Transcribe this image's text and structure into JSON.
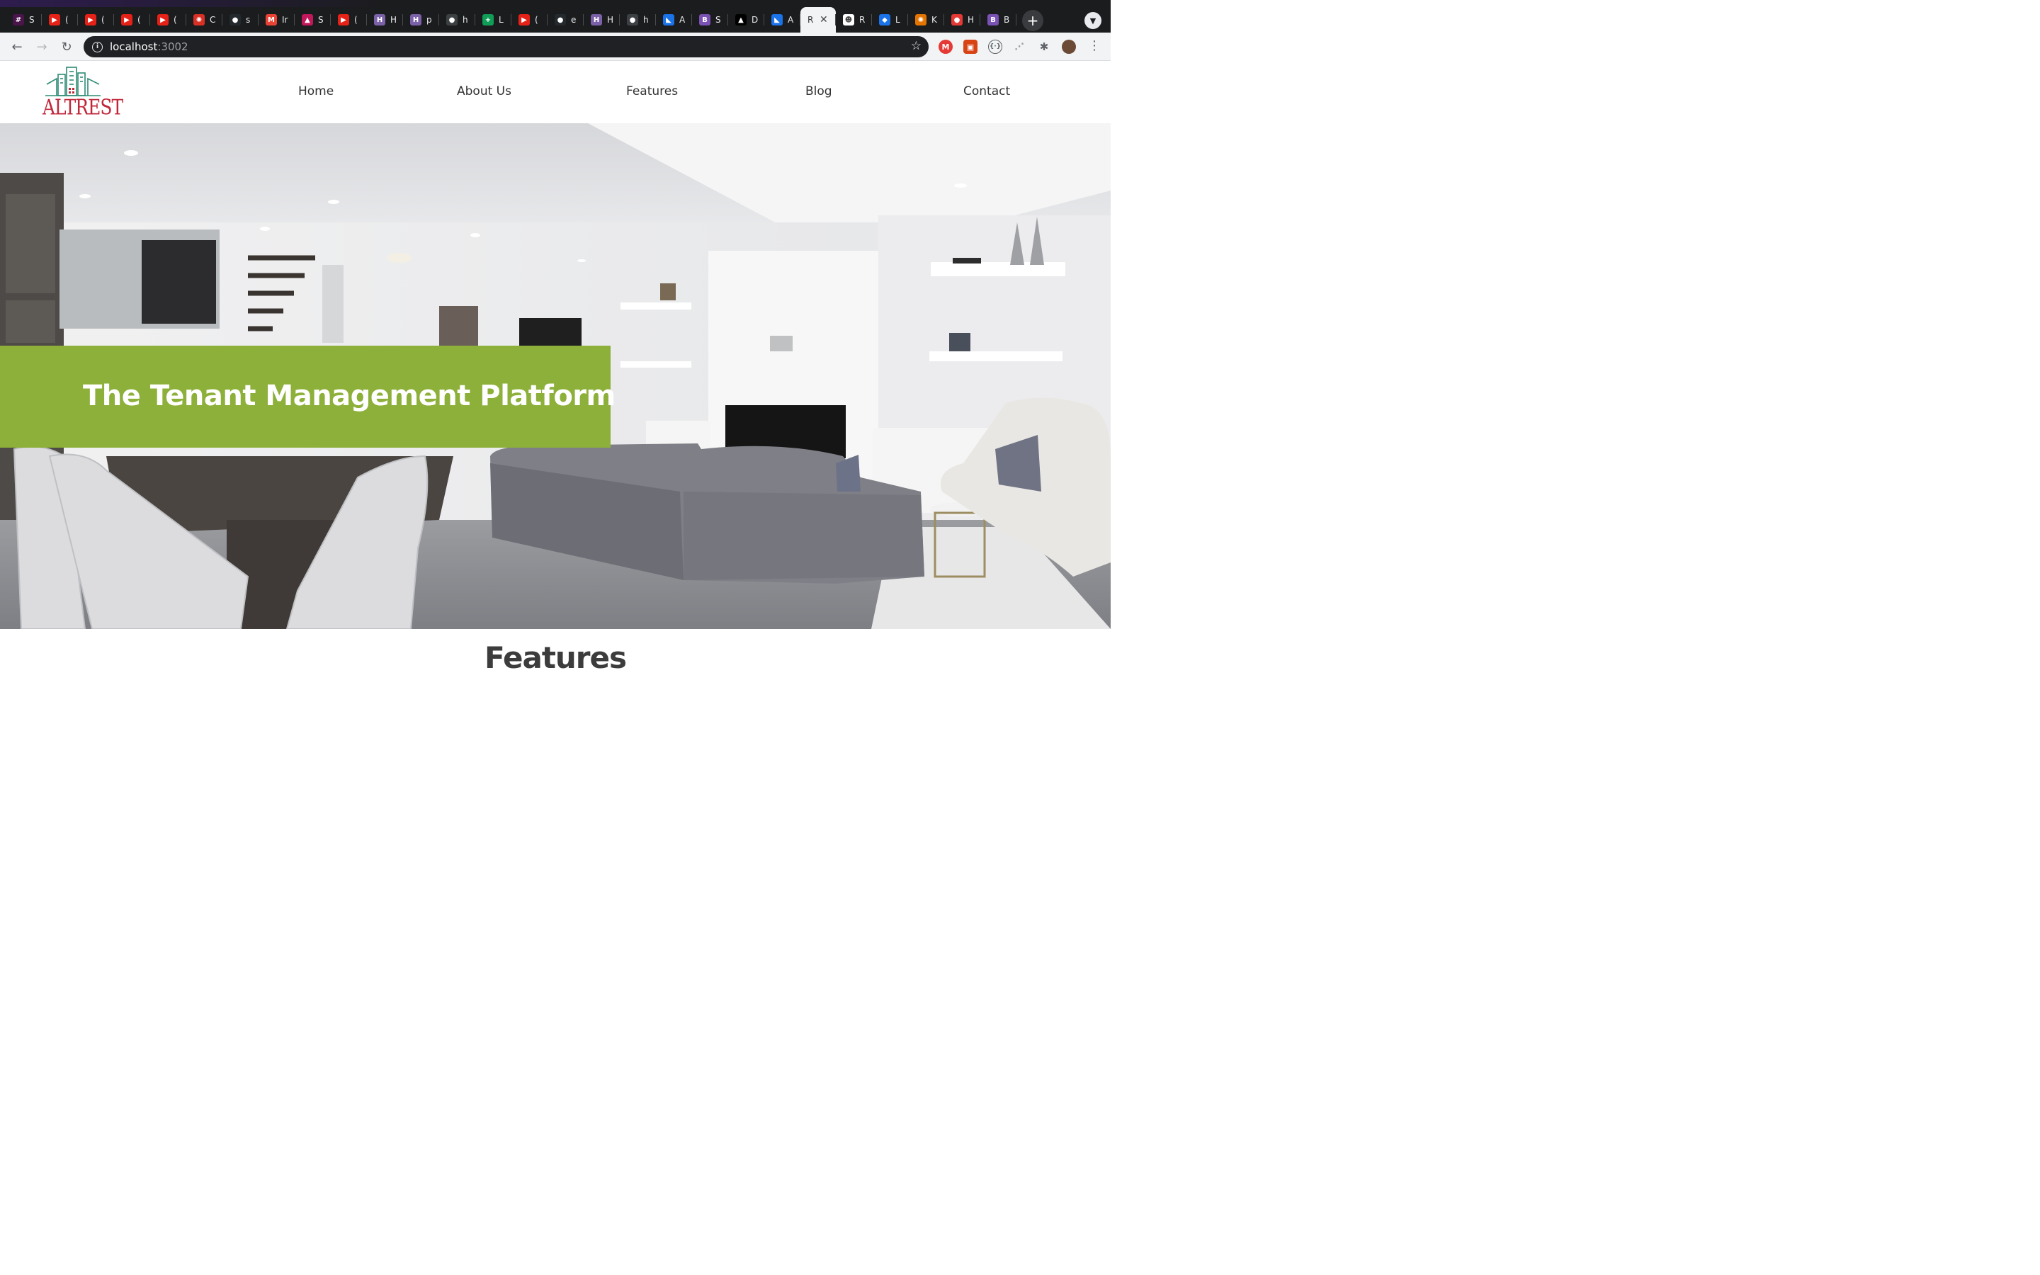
{
  "browser": {
    "tabs": [
      {
        "title": "S",
        "color": "#4a154b",
        "glyph": "#",
        "icon": "slack-icon"
      },
      {
        "title": "(",
        "color": "#e62117",
        "glyph": "▶",
        "icon": "youtube-icon"
      },
      {
        "title": "(",
        "color": "#e62117",
        "glyph": "▶",
        "icon": "youtube-icon"
      },
      {
        "title": "(",
        "color": "#e62117",
        "glyph": "▶",
        "icon": "youtube-icon"
      },
      {
        "title": "(",
        "color": "#e62117",
        "glyph": "▶",
        "icon": "youtube-icon"
      },
      {
        "title": "C",
        "color": "#d93025",
        "glyph": "✺",
        "icon": "sunburst-icon"
      },
      {
        "title": "s",
        "color": "#24292e",
        "glyph": "●",
        "icon": "github-icon"
      },
      {
        "title": "Ir",
        "color": "#ea4335",
        "glyph": "M",
        "icon": "gmail-icon"
      },
      {
        "title": "S",
        "color": "#c2185b",
        "glyph": "▲",
        "icon": "app-icon"
      },
      {
        "title": "(",
        "color": "#e62117",
        "glyph": "▶",
        "icon": "youtube-icon"
      },
      {
        "title": "H",
        "color": "#7b61a8",
        "glyph": "H",
        "icon": "heroku-icon"
      },
      {
        "title": "p",
        "color": "#7b61a8",
        "glyph": "H",
        "icon": "heroku-icon"
      },
      {
        "title": "h",
        "color": "#3c4043",
        "glyph": "●",
        "icon": "globe-icon"
      },
      {
        "title": "L",
        "color": "#0f9d58",
        "glyph": "+",
        "icon": "sheets-icon"
      },
      {
        "title": "(",
        "color": "#e62117",
        "glyph": "▶",
        "icon": "youtube-icon"
      },
      {
        "title": "e",
        "color": "#24292e",
        "glyph": "●",
        "icon": "github-icon"
      },
      {
        "title": "H",
        "color": "#7b61a8",
        "glyph": "H",
        "icon": "heroku-icon"
      },
      {
        "title": "h",
        "color": "#3c4043",
        "glyph": "●",
        "icon": "globe-icon"
      },
      {
        "title": "A",
        "color": "#1a73e8",
        "glyph": "◣",
        "icon": "app-icon"
      },
      {
        "title": "S",
        "color": "#7952b3",
        "glyph": "B",
        "icon": "bootstrap-icon"
      },
      {
        "title": "D",
        "color": "#000000",
        "glyph": "▲",
        "icon": "vercel-icon"
      },
      {
        "title": "A",
        "color": "#1a73e8",
        "glyph": "◣",
        "icon": "app-icon"
      },
      {
        "title": "R",
        "color": "#ffffff",
        "glyph": "",
        "icon": "page-icon",
        "active": true
      },
      {
        "title": "R",
        "color": "#ffffff",
        "glyph": "☻",
        "icon": "app-icon"
      },
      {
        "title": "L",
        "color": "#1a73e8",
        "glyph": "◆",
        "icon": "drop-icon"
      },
      {
        "title": "K",
        "color": "#e37400",
        "glyph": "✺",
        "icon": "app-icon"
      },
      {
        "title": "H",
        "color": "#e53935",
        "glyph": "●",
        "icon": "app-icon"
      },
      {
        "title": "B",
        "color": "#7952b3",
        "glyph": "B",
        "icon": "bootstrap-icon"
      }
    ],
    "url_host": "localhost",
    "url_port": ":3002"
  },
  "site": {
    "logo_text": "ALTREST",
    "nav": [
      "Home",
      "About Us",
      "Features",
      "Blog",
      "Contact"
    ],
    "hero_title": "The Tenant Management Platform",
    "section_title": "Features"
  },
  "colors": {
    "brand_green": "#8db03a",
    "logo_red": "#c0283a",
    "logo_teal": "#2e8b74"
  }
}
